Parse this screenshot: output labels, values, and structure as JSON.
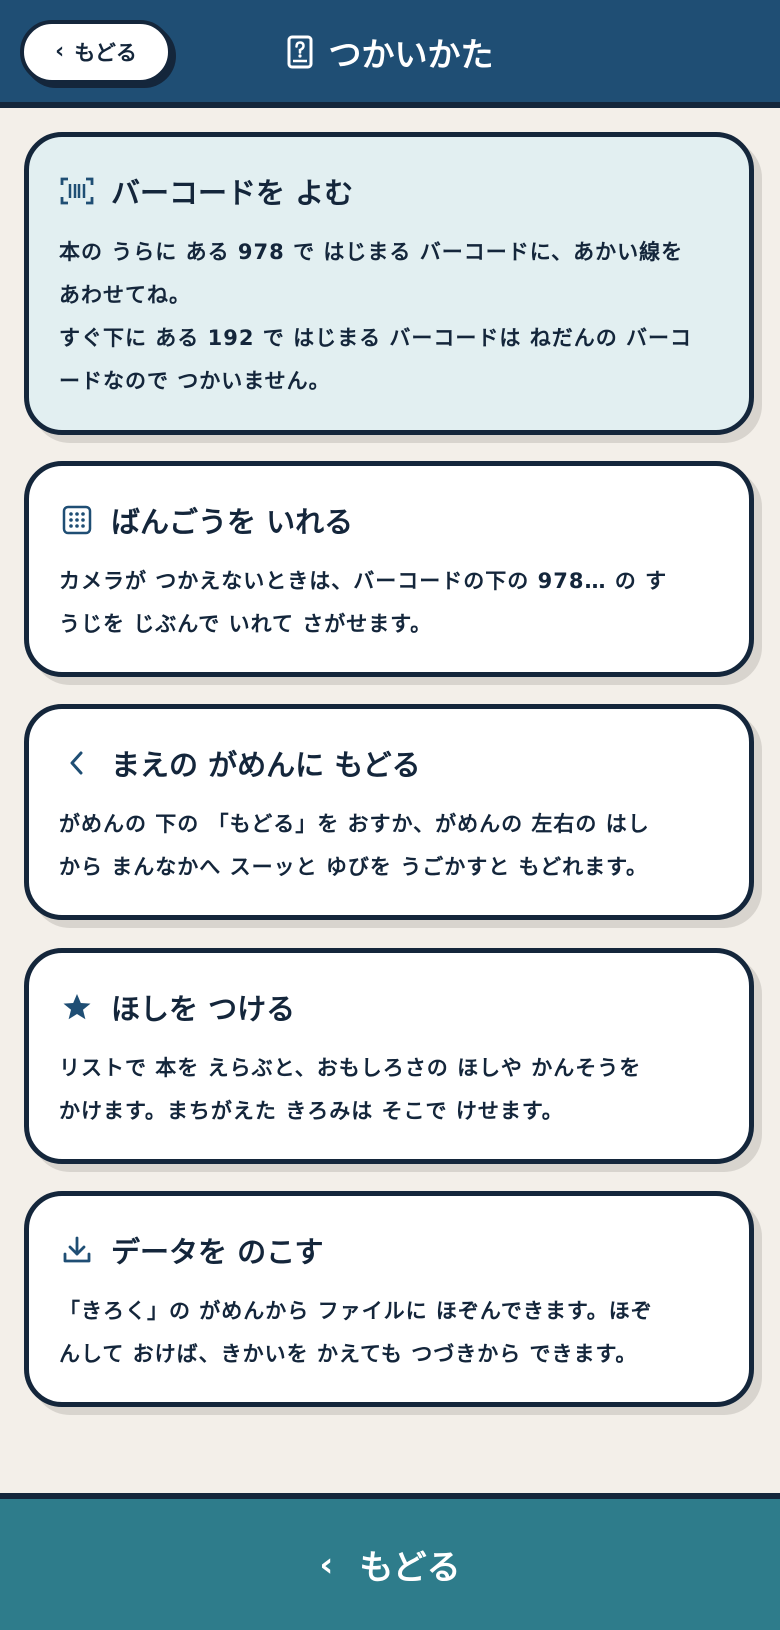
{
  "header": {
    "back_label": "もどる",
    "back_chevron": "‹",
    "title": "つかいかた",
    "title_icon": "help-book-icon"
  },
  "colors": {
    "header_bg": "#1f4e74",
    "footer_bg": "#2e7c8b",
    "ink": "#14263b",
    "highlight_card_bg": "#e2eff1",
    "page_bg": "#f3efe9"
  },
  "cards": [
    {
      "icon": "barcode-scan-icon",
      "title": "バーコードを よむ",
      "lines": [
        "本の うらに ある 978 で はじまる バーコードに、あかい線を",
        "あわせてね。",
        "すぐ下に ある 192 で はじまる バーコードは ねだんの バーコ",
        "ードなので つかいません。"
      ]
    },
    {
      "icon": "keypad-icon",
      "title": "ばんごうを いれる",
      "lines": [
        "カメラが つかえないときは、バーコードの下の 978… の す",
        "うじを じぶんで いれて さがせます。"
      ]
    },
    {
      "icon": "chevron-left-icon",
      "title": "まえの がめんに もどる",
      "lines": [
        "がめんの 下の 「もどる」を おすか、がめんの 左右の はし",
        "から まんなかへ スーッと ゆびを うごかすと もどれます。"
      ]
    },
    {
      "icon": "star-icon",
      "title": "ほしを つける",
      "lines": [
        "リストで 本を えらぶと、おもしろさの ほしや かんそうを",
        "かけます。まちがえた きろみは そこで けせます。"
      ]
    },
    {
      "icon": "download-icon",
      "title": "データを のこす",
      "lines": [
        "「きろく」の がめんから ファイルに ほぞんできます。ほぞ",
        "んして おけば、きかいを かえても つづきから できます。"
      ]
    }
  ],
  "footer": {
    "back_label": "もどる",
    "back_chevron": "‹"
  }
}
